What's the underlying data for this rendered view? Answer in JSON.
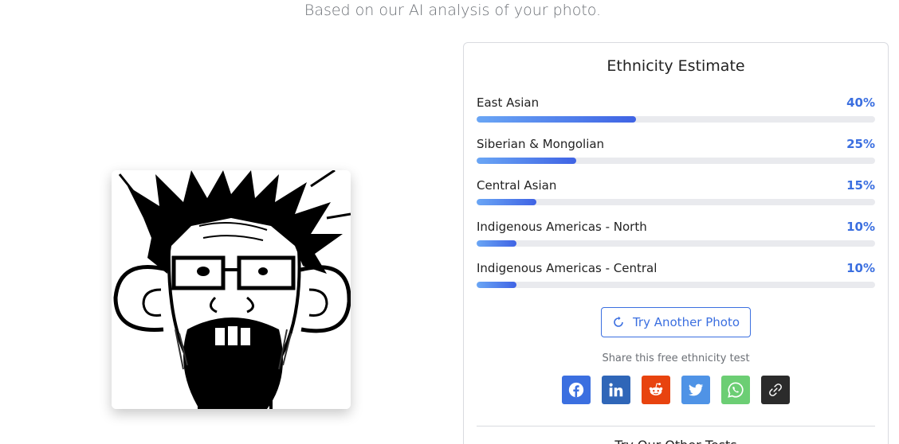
{
  "page": {
    "subtitle": "Based on our AI analysis of your photo."
  },
  "photo": {
    "alt": "Uploaded photo"
  },
  "card": {
    "title": "Ethnicity Estimate",
    "results": [
      {
        "label": "East Asian",
        "percent_text": "40%",
        "value": 40
      },
      {
        "label": "Siberian & Mongolian",
        "percent_text": "25%",
        "value": 25
      },
      {
        "label": "Central Asian",
        "percent_text": "15%",
        "value": 15
      },
      {
        "label": "Indigenous Americas - North",
        "percent_text": "10%",
        "value": 10
      },
      {
        "label": "Indigenous Americas - Central",
        "percent_text": "10%",
        "value": 10
      }
    ],
    "try_button": {
      "label": "Try Another Photo",
      "icon": "refresh-icon"
    },
    "share_text": "Share this free ethnicity test",
    "share_buttons": [
      {
        "name": "facebook",
        "icon": "facebook-icon",
        "color": "#3b6fe0"
      },
      {
        "name": "linkedin",
        "icon": "linkedin-icon",
        "color": "#2f66b8"
      },
      {
        "name": "reddit",
        "icon": "reddit-icon",
        "color": "#e8430f"
      },
      {
        "name": "twitter",
        "icon": "twitter-icon",
        "color": "#4f93e6"
      },
      {
        "name": "whatsapp",
        "icon": "whatsapp-icon",
        "color": "#6cce74"
      },
      {
        "name": "copy-link",
        "icon": "link-icon",
        "color": "#2b2b2b"
      }
    ],
    "other_tests_heading": "Try Our Other Tests"
  },
  "colors": {
    "accent": "#3b6fe0",
    "bar_gradient_start": "#6aa6f5",
    "bar_gradient_end": "#3f63e4",
    "track": "#e9eaee"
  }
}
